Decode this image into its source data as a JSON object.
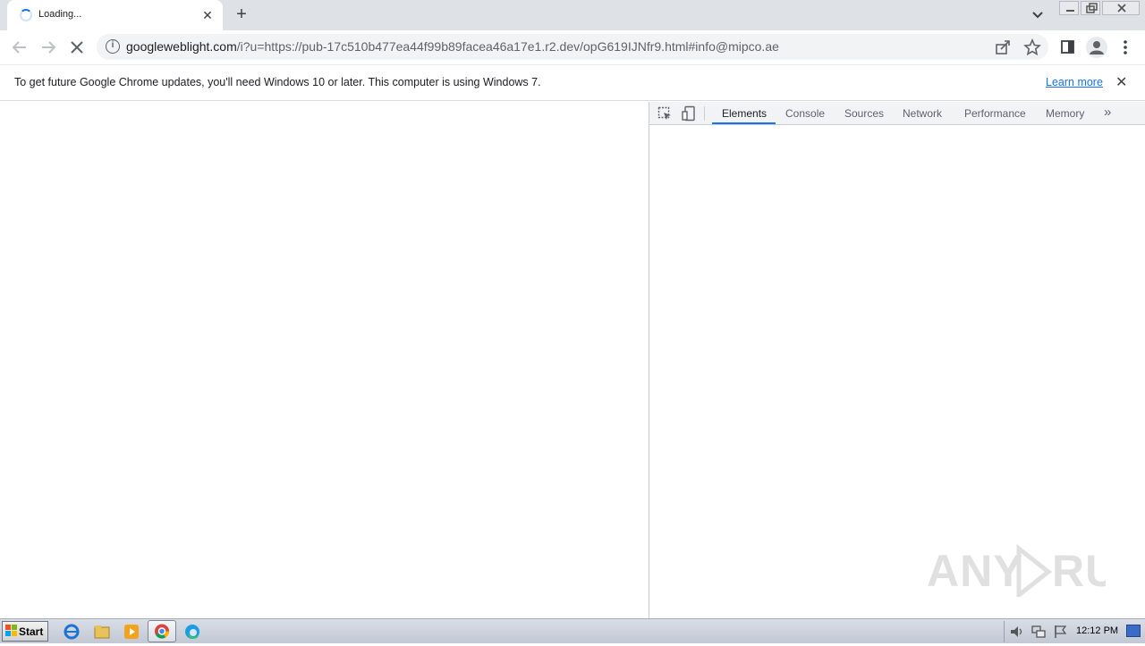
{
  "browser": {
    "tab_title": "Loading...",
    "new_tab_symbol": "+",
    "url_host": "googleweblight.com",
    "url_rest": "/i?u=https://pub-17c510b477ea44f99b89facea46a17e1.r2.dev/opG619IJNfr9.html#info@mipco.ae"
  },
  "infobar": {
    "message": "To get future Google Chrome updates, you'll need Windows 10 or later. This computer is using Windows 7.",
    "learn_more": "Learn more"
  },
  "devtools": {
    "tabs": [
      "Elements",
      "Console",
      "Sources",
      "Network",
      "Performance",
      "Memory"
    ],
    "active_tab": "Elements",
    "more_symbol": "»"
  },
  "watermark": "ANY RUN",
  "taskbar": {
    "start_label": "Start",
    "clock": "12:12 PM"
  },
  "colors": {
    "accent": "#1a73e8",
    "tabstrip": "#dee1e6"
  }
}
